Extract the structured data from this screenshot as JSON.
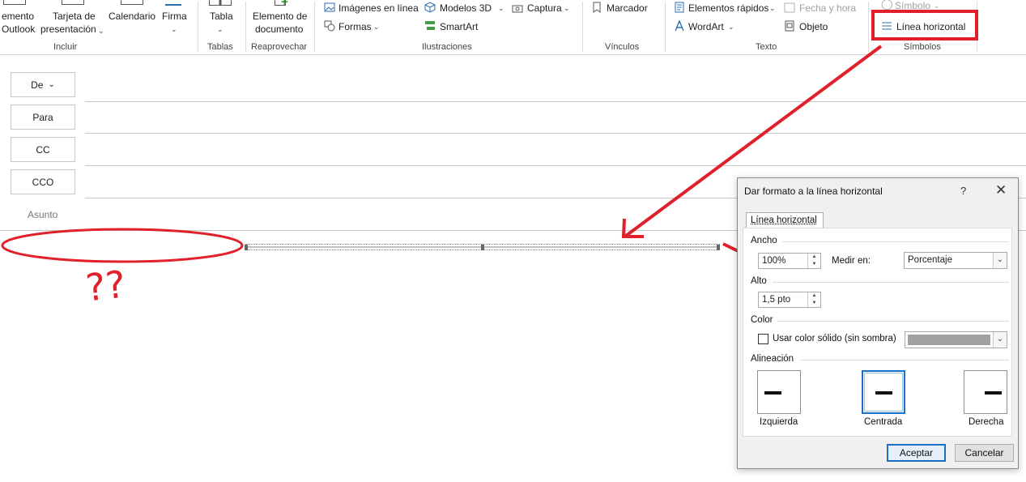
{
  "ribbon": {
    "incluir": {
      "outlook_line1": "emento",
      "outlook_line2": "Outlook",
      "tarjeta_line1": "Tarjeta de",
      "tarjeta_line2": "presentación",
      "calendario": "Calendario",
      "firma": "Firma",
      "group_label": "Incluir"
    },
    "tablas": {
      "tabla": "Tabla",
      "group_label": "Tablas"
    },
    "reaprovechar": {
      "line1": "Elemento de",
      "line2": "documento",
      "group_label": "Reaprovechar"
    },
    "ilustraciones": {
      "imagenes": "Imágenes en línea",
      "modelos": "Modelos 3D",
      "captura": "Captura",
      "formas": "Formas",
      "smartart": "SmartArt",
      "group_label": "Ilustraciones"
    },
    "vinculos": {
      "marcador": "Marcador",
      "group_label": "Vínculos"
    },
    "texto": {
      "elementos": "Elementos rápidos",
      "fecha": "Fecha y hora",
      "wordart": "WordArt",
      "objeto": "Objeto",
      "group_label": "Texto"
    },
    "simbolos": {
      "simbolo": "Símbolo",
      "linea": "Línea horizontal",
      "group_label": "Símbolos"
    }
  },
  "mail": {
    "de": "De",
    "para": "Para",
    "cc": "CC",
    "cco": "CCO",
    "asunto": "Asunto"
  },
  "annotation": {
    "scribble": "??"
  },
  "dialog": {
    "title": "Dar formato a la línea horizontal",
    "help": "?",
    "close": "✕",
    "tab": "Línea horizontal",
    "ancho_label": "Ancho",
    "ancho_value": "100%",
    "medir_label": "Medir en:",
    "medir_value": "Porcentaje",
    "alto_label": "Alto",
    "alto_value": "1,5 pto",
    "color_label": "Color",
    "color_checkbox": "Usar color sólido (sin sombra)",
    "color_swatch": "#a0a0a0",
    "alineacion_label": "Alineación",
    "izquierda": "Izquierda",
    "centrada": "Centrada",
    "derecha": "Derecha",
    "aceptar": "Aceptar",
    "cancelar": "Cancelar"
  },
  "colors": {
    "annotation_red": "#e0202a",
    "accent_blue": "#1c6fc4"
  }
}
